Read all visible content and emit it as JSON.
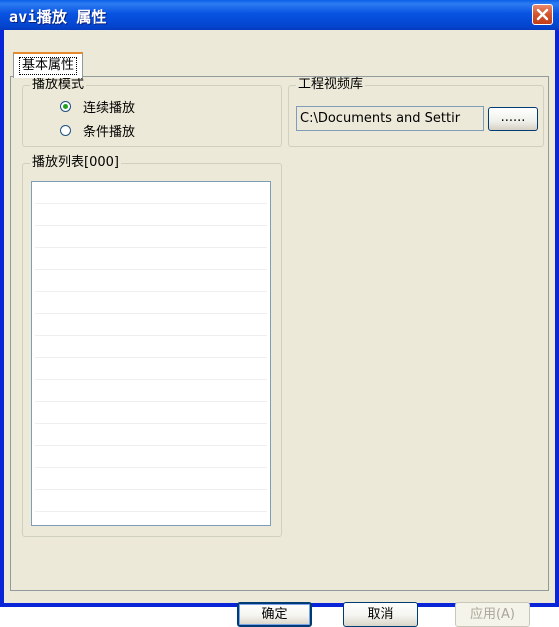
{
  "window": {
    "title": "avi播放 属性",
    "close_icon": "close-icon"
  },
  "tabs": [
    {
      "label": "基本属性",
      "active": true
    }
  ],
  "play_mode": {
    "legend": "播放模式",
    "options": [
      {
        "label": "连续播放",
        "checked": true
      },
      {
        "label": "条件播放",
        "checked": false
      }
    ]
  },
  "video_library": {
    "legend": "工程视频库",
    "path": "C:\\Documents and Settir",
    "browse_label": "......"
  },
  "playlist": {
    "legend": "播放列表[000]",
    "items": []
  },
  "buttons": {
    "ok": "确定",
    "cancel": "取消",
    "apply": "应用(A)"
  }
}
